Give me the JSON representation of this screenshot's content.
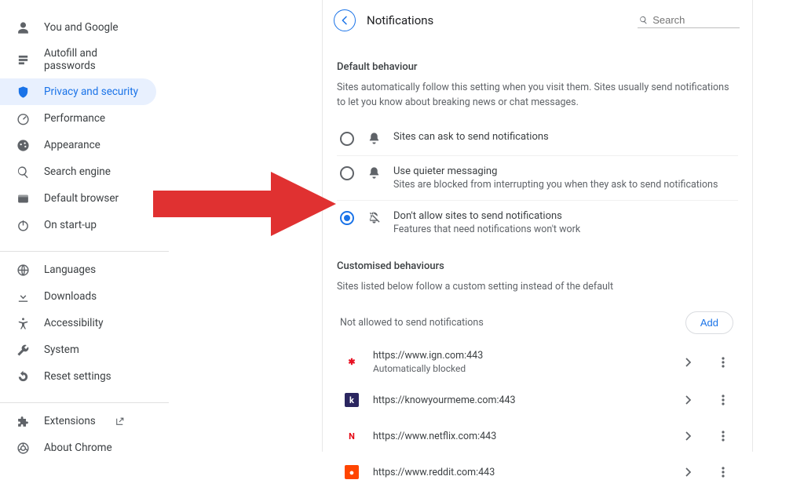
{
  "sidebar": {
    "items": [
      {
        "label": "You and Google",
        "icon": "person"
      },
      {
        "label": "Autofill and passwords",
        "icon": "autofill"
      },
      {
        "label": "Privacy and security",
        "icon": "shield",
        "active": true
      },
      {
        "label": "Performance",
        "icon": "speed"
      },
      {
        "label": "Appearance",
        "icon": "palette"
      },
      {
        "label": "Search engine",
        "icon": "search"
      },
      {
        "label": "Default browser",
        "icon": "browser"
      },
      {
        "label": "On start-up",
        "icon": "power"
      }
    ],
    "items2": [
      {
        "label": "Languages",
        "icon": "globe"
      },
      {
        "label": "Downloads",
        "icon": "download"
      },
      {
        "label": "Accessibility",
        "icon": "accessibility"
      },
      {
        "label": "System",
        "icon": "wrench"
      },
      {
        "label": "Reset settings",
        "icon": "reset"
      }
    ],
    "items3": [
      {
        "label": "Extensions",
        "icon": "extension",
        "external": true
      },
      {
        "label": "About Chrome",
        "icon": "chrome"
      }
    ]
  },
  "header": {
    "title": "Notifications",
    "search_placeholder": "Search"
  },
  "default_behaviour": {
    "heading": "Default behaviour",
    "desc": "Sites automatically follow this setting when you visit them. Sites usually send notifications to let you know about breaking news or chat messages.",
    "options": [
      {
        "title": "Sites can ask to send notifications",
        "sub": "",
        "icon": "bell",
        "selected": false
      },
      {
        "title": "Use quieter messaging",
        "sub": "Sites are blocked from interrupting you when they ask to send notifications",
        "icon": "bell",
        "selected": false
      },
      {
        "title": "Don't allow sites to send notifications",
        "sub": "Features that need notifications won't work",
        "icon": "bell-off",
        "selected": true
      }
    ]
  },
  "custom": {
    "heading": "Customised behaviours",
    "desc": "Sites listed below follow a custom setting instead of the default",
    "block_heading": "Not allowed to send notifications",
    "add_label": "Add",
    "sites": [
      {
        "url": "https://www.ign.com:443",
        "sub": "Automatically blocked",
        "fav": {
          "bg": "#fff",
          "fg": "#e81123",
          "txt": "✱"
        }
      },
      {
        "url": "https://knowyourmeme.com:443",
        "sub": "",
        "fav": {
          "bg": "#2b2660",
          "fg": "#fff",
          "txt": "k"
        }
      },
      {
        "url": "https://www.netflix.com:443",
        "sub": "",
        "fav": {
          "bg": "#fff",
          "fg": "#e50914",
          "txt": "N"
        }
      },
      {
        "url": "https://www.reddit.com:443",
        "sub": "",
        "fav": {
          "bg": "#ff4500",
          "fg": "#fff",
          "txt": "●"
        }
      }
    ]
  }
}
